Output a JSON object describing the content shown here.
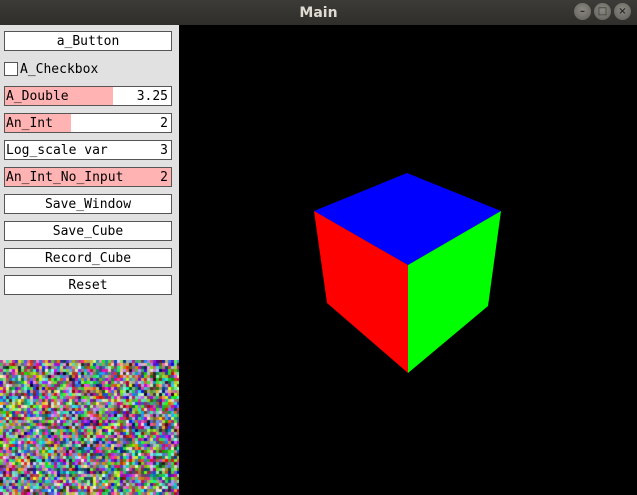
{
  "window": {
    "title": "Main"
  },
  "controls": {
    "a_button": "a_Button",
    "checkbox": {
      "label": "A_Checkbox",
      "checked": false
    },
    "a_double": {
      "label": "A_Double",
      "value": "3.25",
      "fill_fraction": 0.65
    },
    "an_int": {
      "label": "An_Int",
      "value": "2",
      "fill_fraction": 0.4
    },
    "log_scale": {
      "label": "Log_scale var",
      "value": "3",
      "fill_fraction": 0.0
    },
    "an_int_no_input": {
      "label": "An_Int_No_Input",
      "value": "2",
      "fill_fraction": 1.0
    },
    "save_window": "Save_Window",
    "save_cube": "Save_Cube",
    "record_cube": "Record_Cube",
    "reset": "Reset"
  },
  "scene": {
    "background": "#000000",
    "faces": {
      "top": "#0000ff",
      "left": "#ff0000",
      "right": "#00ff00"
    }
  }
}
